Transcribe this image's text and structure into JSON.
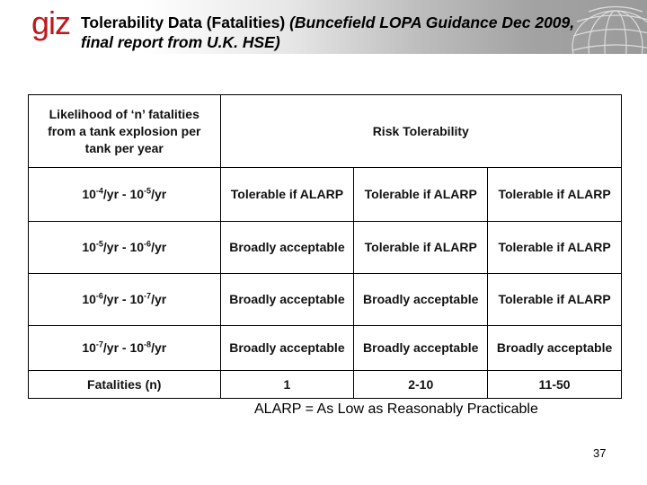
{
  "header": {
    "logo": "giz",
    "title_plain": "Tolerability Data (Fatalities) ",
    "title_italic_line1": "(Buncefield LOPA Guidance Dec 2009,",
    "title_italic_line2": "final report from U.K. HSE)",
    "logo_color": "#c0171c"
  },
  "table": {
    "header_col0": "Likelihood of ‘n’ fatalities from a tank explosion per tank per year",
    "header_span": "Risk Tolerability",
    "rows": [
      {
        "likelihood": {
          "a": "10",
          "a_exp": "-4",
          "b": "/yr - 10",
          "b_exp": "-5",
          "c": "/yr"
        },
        "cells": [
          "Tolerable if ALARP",
          "Tolerable if ALARP",
          "Tolerable if ALARP"
        ]
      },
      {
        "likelihood": {
          "a": "10",
          "a_exp": "-5",
          "b": "/yr - 10",
          "b_exp": "-6",
          "c": "/yr"
        },
        "cells": [
          "Broadly acceptable",
          "Tolerable if ALARP",
          "Tolerable if ALARP"
        ]
      },
      {
        "likelihood": {
          "a": "10",
          "a_exp": "-6",
          "b": "/yr - 10",
          "b_exp": "-7",
          "c": "/yr"
        },
        "cells": [
          "Broadly acceptable",
          "Broadly acceptable",
          "Tolerable if ALARP"
        ]
      },
      {
        "likelihood": {
          "a": "10",
          "a_exp": "-7",
          "b": "/yr - 10",
          "b_exp": "-8",
          "c": "/yr"
        },
        "cells": [
          "Broadly acceptable",
          "Broadly acceptable",
          "Broadly acceptable"
        ]
      }
    ],
    "footer_label": "Fatalities (n)",
    "footer_values": [
      "1",
      "2-10",
      "11-50"
    ]
  },
  "note": "ALARP = As Low as Reasonably Practicable",
  "page_number": "37"
}
